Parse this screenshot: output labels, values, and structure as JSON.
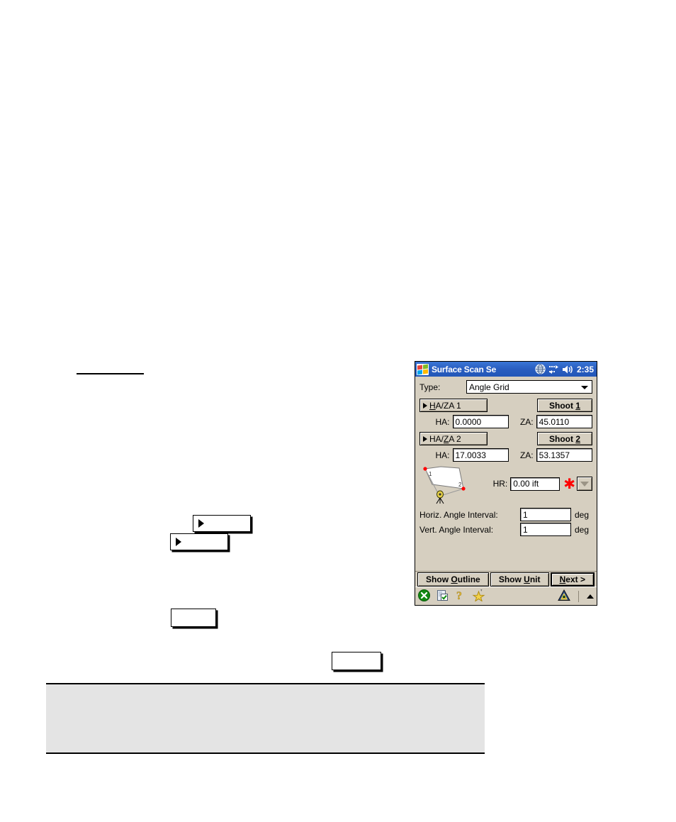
{
  "pda": {
    "titlebar": {
      "logo_icon": "windows-flag-icon",
      "title": "Surface Scan Se",
      "icons": [
        "globe-icon",
        "connectivity-icon",
        "speaker-icon"
      ],
      "clock": "2:35",
      "bg_color": "#2a5ec0",
      "text_color": "#ffffff"
    },
    "form": {
      "type_label": "Type:",
      "type_value": "Angle Grid",
      "type_options": [
        "Angle Grid"
      ],
      "group1": {
        "toggle_label": "HA/ZA 1",
        "toggle_accesskey": "HA",
        "shoot_label": "Shoot 1",
        "ha_label": "HA:",
        "ha_value": "0.0000",
        "za_label": "ZA:",
        "za_value": "45.0110"
      },
      "group2": {
        "toggle_label": "HA/ZA 2",
        "toggle_accesskey": "ZA",
        "shoot_label": "Shoot 2",
        "ha_label": "HA:",
        "ha_value": "17.0033",
        "za_label": "ZA:",
        "za_value": "53.1357"
      },
      "sketch": {
        "icon": "surface-outline-sketch-icon",
        "point1_label": "1",
        "point2_label": "2",
        "point_color": "#ff0000",
        "instrument_color": "#e8d24a"
      },
      "hr_label": "HR:",
      "hr_value": "0.00 ift",
      "hr_asterisk_icon": "red-asterisk-icon",
      "hr_asterisk_color": "#ff0000",
      "hr_dropdown_icon": "chevron-down-icon",
      "horiz_interval_label": "Horiz. Angle Interval:",
      "horiz_interval_value": "1",
      "horiz_interval_unit": "deg",
      "vert_interval_label": "Vert. Angle Interval:",
      "vert_interval_value": "1",
      "vert_interval_unit": "deg"
    },
    "commandbar": {
      "show_outline_label": "Show Outline",
      "show_unit_label": "Show Unit",
      "next_label": "Next >"
    },
    "taskbar": {
      "icons": [
        "close-circle-icon",
        "clipboard-check-icon",
        "help-question-icon",
        "favorites-star-icon",
        "warning-triangle-icon",
        "tray-up-arrow-icon"
      ],
      "bg_color": "#d6cfc0"
    }
  },
  "document": {
    "rule": "",
    "callouts": [
      {
        "name": "callout-a",
        "text": ""
      },
      {
        "name": "callout-b",
        "text": ""
      },
      {
        "name": "callout-c",
        "text": ""
      },
      {
        "name": "callout-d",
        "text": ""
      }
    ],
    "note_box": {
      "text": "",
      "bg_color": "#e4e4e4"
    }
  }
}
